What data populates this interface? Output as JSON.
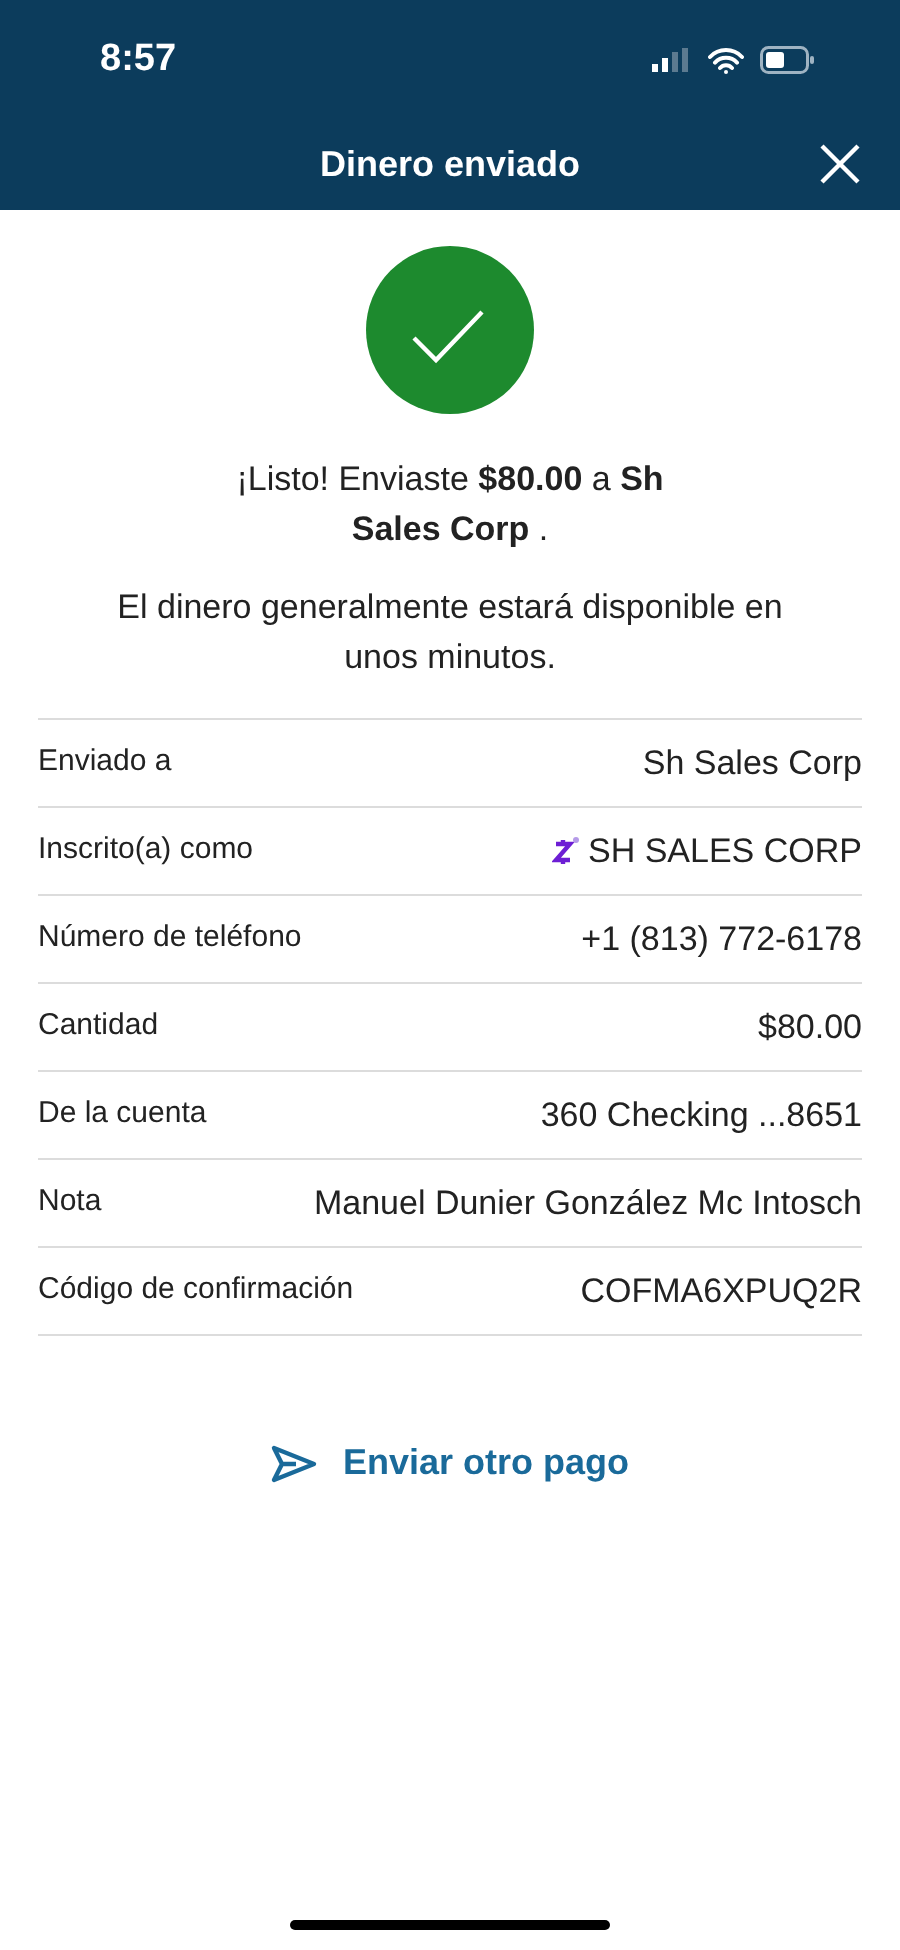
{
  "status_bar": {
    "time": "8:57"
  },
  "header": {
    "title": "Dinero enviado"
  },
  "confirmation": {
    "message": "¡Listo! Enviaste **$80.00** a **Sh Sales Corp** .",
    "note": "El dinero generalmente estará disponible en unos minutos."
  },
  "details": [
    {
      "kind": "plain",
      "label": "Enviado a",
      "value": "Sh Sales Corp"
    },
    {
      "kind": "zelle",
      "label": "Inscrito(a) como",
      "value": "SH SALES CORP"
    },
    {
      "kind": "plain",
      "label": "Número de teléfono",
      "value": "+1 (813) 772-6178"
    },
    {
      "kind": "plain",
      "label": "Cantidad",
      "value": "$80.00"
    },
    {
      "kind": "plain",
      "label": "De la cuenta",
      "value": "360 Checking ...8651"
    },
    {
      "kind": "plain",
      "label": "Nota",
      "value": "Manuel Dunier González Mc Intosch"
    },
    {
      "kind": "plain",
      "label": "Código de confirmación",
      "value": "COFMA6XPUQ2R"
    }
  ],
  "action": {
    "label": "Enviar otro pago"
  }
}
